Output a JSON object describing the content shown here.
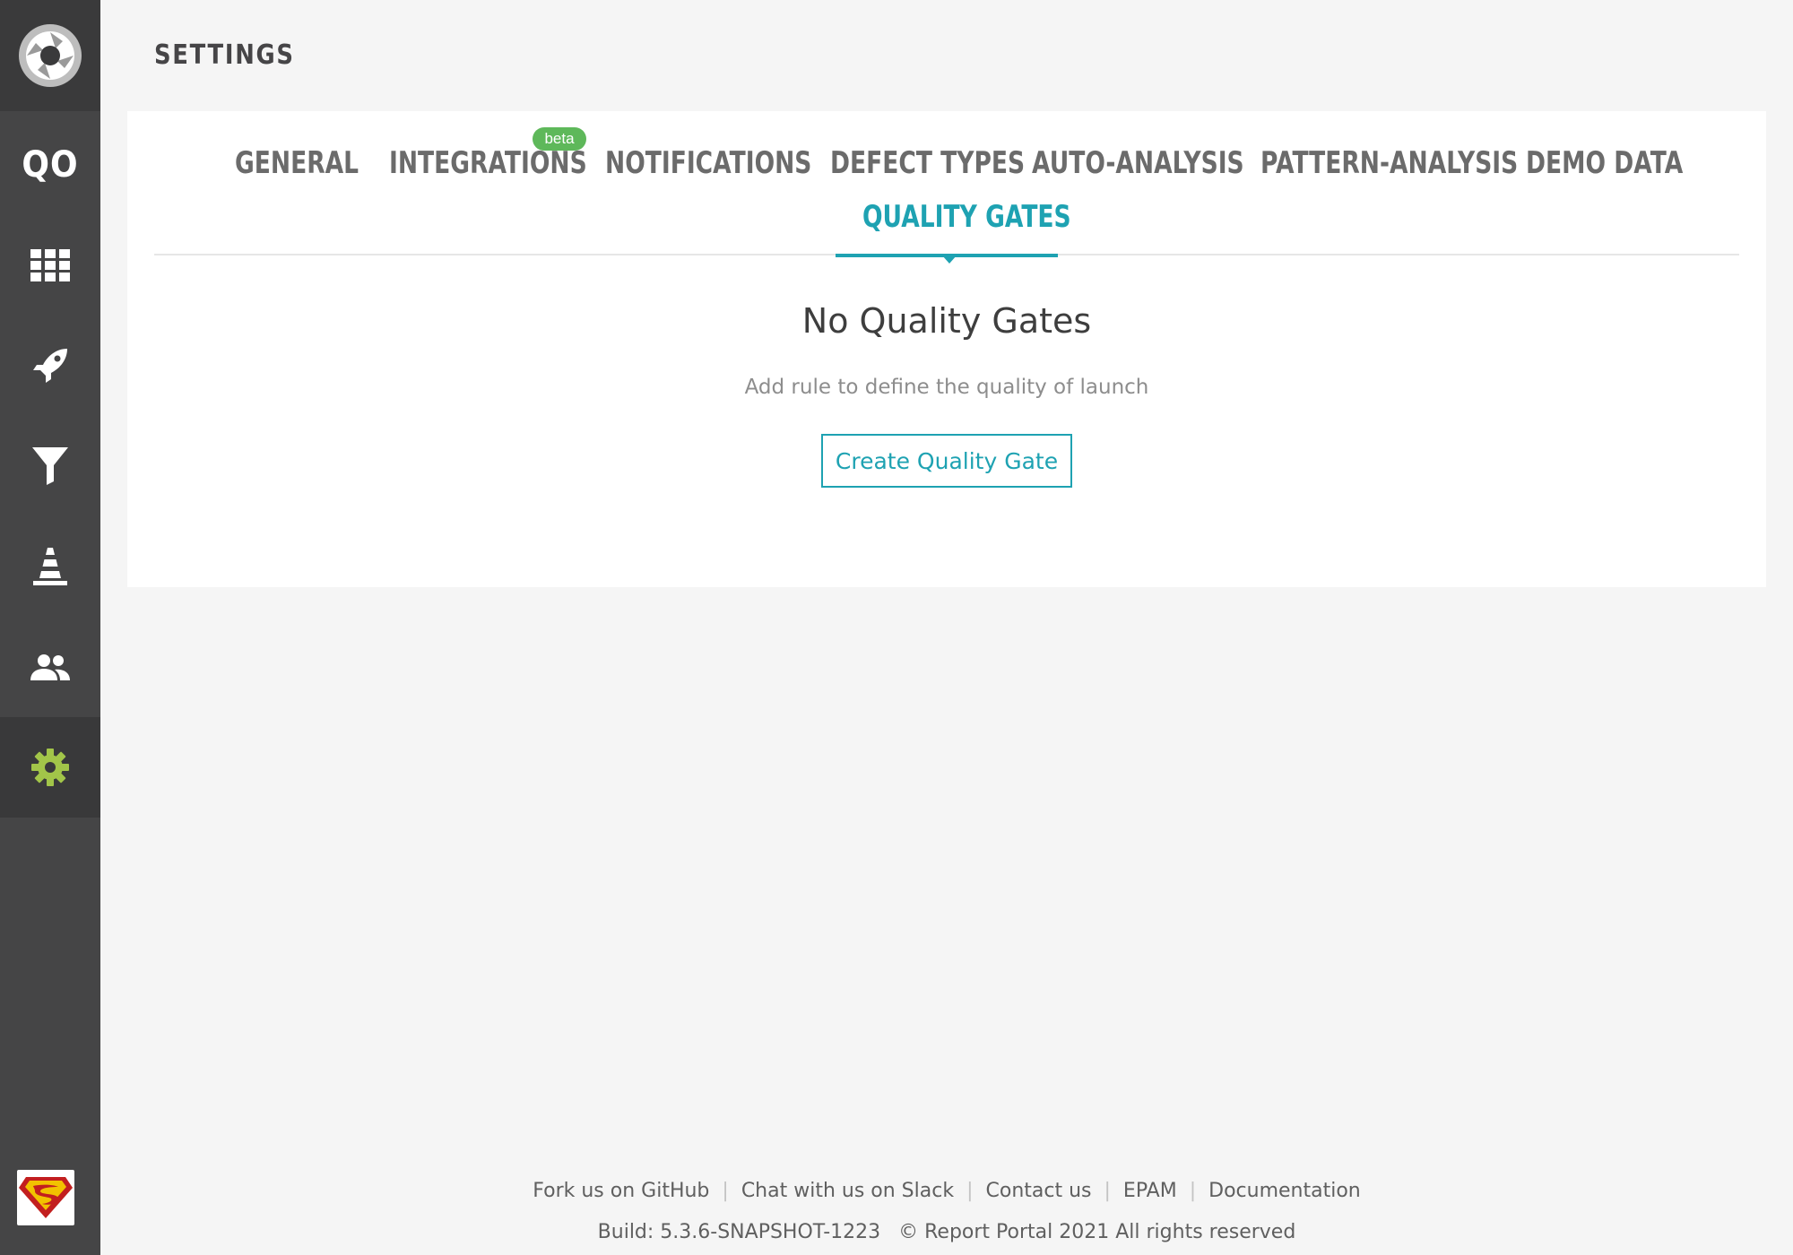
{
  "sidebar": {
    "logo_icon": "report-portal-aperture-icon",
    "project_abbr": "QO",
    "items": [
      {
        "name": "dashboards",
        "icon": "grid-icon"
      },
      {
        "name": "launches",
        "icon": "rocket-icon"
      },
      {
        "name": "filters",
        "icon": "filter-icon"
      },
      {
        "name": "debug",
        "icon": "cone-icon"
      },
      {
        "name": "members",
        "icon": "people-icon"
      },
      {
        "name": "settings",
        "icon": "gear-icon",
        "active": true
      }
    ],
    "avatar_icon": "superman-avatar-icon"
  },
  "header": {
    "title": "SETTINGS"
  },
  "tabs": [
    {
      "label": "GENERAL"
    },
    {
      "label": "INTEGRATIONS",
      "badge": "beta"
    },
    {
      "label": "NOTIFICATIONS"
    },
    {
      "label": "DEFECT TYPES"
    },
    {
      "label": "AUTO-ANALYSIS"
    },
    {
      "label": "PATTERN-ANALYSIS"
    },
    {
      "label": "DEMO DATA"
    },
    {
      "label": "QUALITY GATES",
      "active": true
    }
  ],
  "empty_state": {
    "title": "No Quality Gates",
    "subtitle": "Add rule to define the quality of launch",
    "button_label": "Create Quality Gate"
  },
  "footer": {
    "links": [
      "Fork us on GitHub",
      "Chat with us on Slack",
      "Contact us",
      "EPAM",
      "Documentation"
    ],
    "build": "Build: 5.3.6-SNAPSHOT-1223",
    "copyright": "© Report Portal 2021 All rights reserved"
  },
  "colors": {
    "accent": "#1ea2b2",
    "active_icon": "#a2c549",
    "beta_badge": "#5eb85a",
    "sidebar_bg": "#454546"
  }
}
